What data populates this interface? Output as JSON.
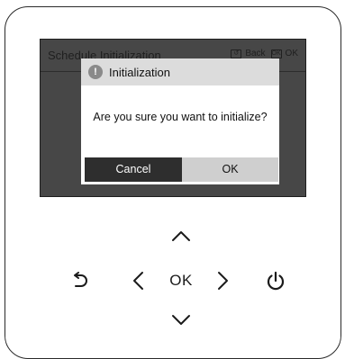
{
  "screen": {
    "title": "Schedule Initialization",
    "hints": [
      {
        "key": "↺",
        "label": "Back"
      },
      {
        "key": "OK",
        "label": "OK"
      }
    ]
  },
  "dialog": {
    "title": "Initialization",
    "alert_symbol": "!",
    "message": "Are you sure you want to initialize?",
    "cancel_label": "Cancel",
    "ok_label": "OK"
  },
  "keypad": {
    "ok_label": "OK",
    "icons": [
      "up-arrow-icon",
      "down-arrow-icon",
      "left-arrow-icon",
      "right-arrow-icon",
      "back-icon",
      "power-icon"
    ]
  }
}
